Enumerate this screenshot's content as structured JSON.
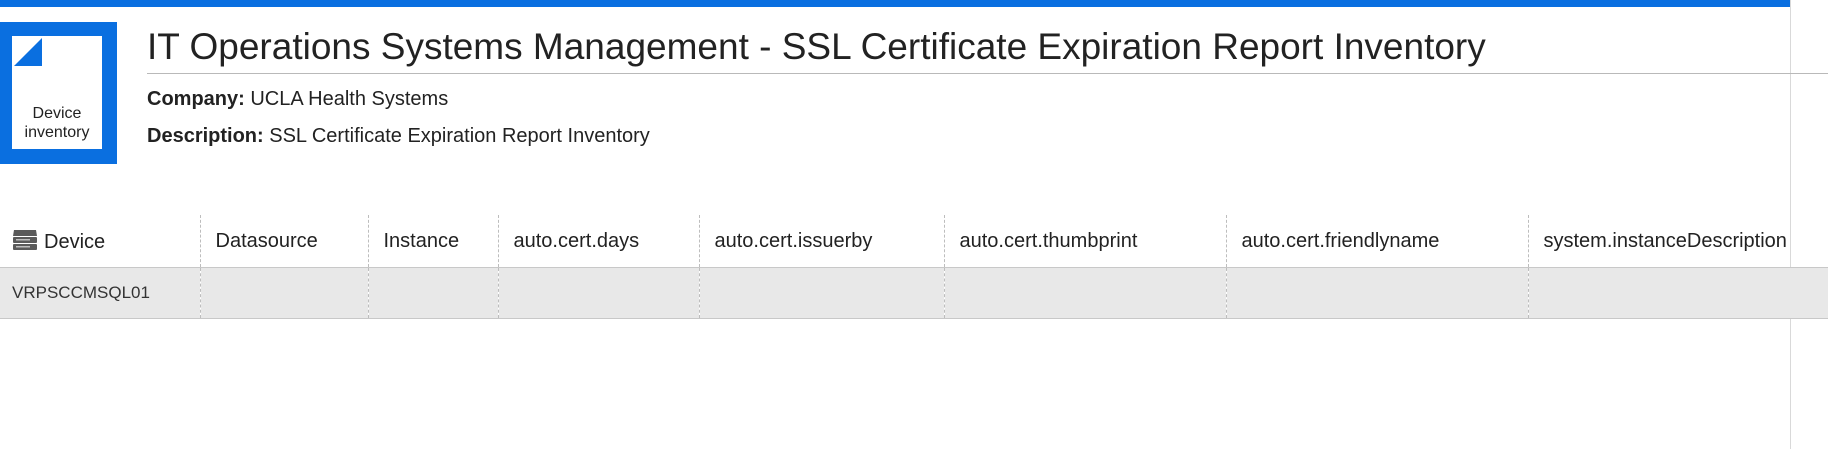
{
  "colors": {
    "accent": "#0a6fe0",
    "row_background": "#e8e8e8",
    "rule": "#b9b9b9"
  },
  "icon": {
    "name": "document-icon",
    "label_line1": "Device",
    "label_line2": "inventory"
  },
  "header": {
    "title": "IT Operations Systems Management - SSL Certificate Expiration Report Inventory",
    "company_label": "Company:",
    "company_value": "UCLA Health Systems",
    "description_label": "Description:",
    "description_value": "SSL Certificate Expiration Report Inventory"
  },
  "table": {
    "device_icon": "server-stack-icon",
    "columns": [
      "Device",
      "Datasource",
      "Instance",
      "auto.cert.days",
      "auto.cert.issuerby",
      "auto.cert.thumbprint",
      "auto.cert.friendlyname",
      "system.instanceDescription"
    ],
    "rows": [
      [
        "VRPSCCMSQL01",
        "",
        "",
        "",
        "",
        "",
        "",
        ""
      ]
    ]
  }
}
